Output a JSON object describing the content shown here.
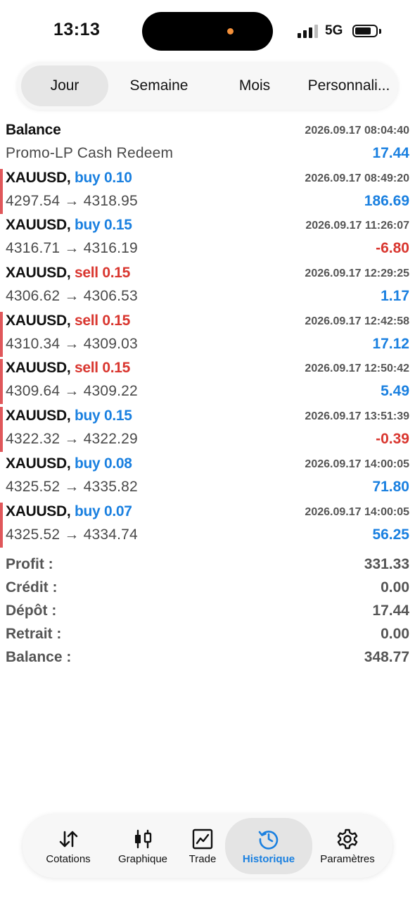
{
  "status_bar": {
    "time": "13:13",
    "network": "5G"
  },
  "period_tabs": [
    {
      "label": "Jour",
      "active": true
    },
    {
      "label": "Semaine",
      "active": false
    },
    {
      "label": "Mois",
      "active": false
    },
    {
      "label": "Personnali...",
      "active": false
    }
  ],
  "deals": [
    {
      "kind": "balance",
      "title": "Balance",
      "time": "2026.09.17 08:04:40",
      "detail": "Promo-LP Cash Redeem",
      "amount": "17.44",
      "sign": "pos",
      "marked": false
    },
    {
      "kind": "trade",
      "symbol": "XAUUSD,",
      "side": "buy",
      "volume": "0.10",
      "time": "2026.09.17 08:49:20",
      "open_price": "4297.54",
      "close_price": "4318.95",
      "amount": "186.69",
      "sign": "pos",
      "marked": true
    },
    {
      "kind": "trade",
      "symbol": "XAUUSD,",
      "side": "buy",
      "volume": "0.15",
      "time": "2026.09.17 11:26:07",
      "open_price": "4316.71",
      "close_price": "4316.19",
      "amount": "-6.80",
      "sign": "neg",
      "marked": false
    },
    {
      "kind": "trade",
      "symbol": "XAUUSD,",
      "side": "sell",
      "volume": "0.15",
      "time": "2026.09.17 12:29:25",
      "open_price": "4306.62",
      "close_price": "4306.53",
      "amount": "1.17",
      "sign": "pos",
      "marked": false
    },
    {
      "kind": "trade",
      "symbol": "XAUUSD,",
      "side": "sell",
      "volume": "0.15",
      "time": "2026.09.17 12:42:58",
      "open_price": "4310.34",
      "close_price": "4309.03",
      "amount": "17.12",
      "sign": "pos",
      "marked": true
    },
    {
      "kind": "trade",
      "symbol": "XAUUSD,",
      "side": "sell",
      "volume": "0.15",
      "time": "2026.09.17 12:50:42",
      "open_price": "4309.64",
      "close_price": "4309.22",
      "amount": "5.49",
      "sign": "pos",
      "marked": true
    },
    {
      "kind": "trade",
      "symbol": "XAUUSD,",
      "side": "buy",
      "volume": "0.15",
      "time": "2026.09.17 13:51:39",
      "open_price": "4322.32",
      "close_price": "4322.29",
      "amount": "-0.39",
      "sign": "neg",
      "marked": true
    },
    {
      "kind": "trade",
      "symbol": "XAUUSD,",
      "side": "buy",
      "volume": "0.08",
      "time": "2026.09.17 14:00:05",
      "open_price": "4325.52",
      "close_price": "4335.82",
      "amount": "71.80",
      "sign": "pos",
      "marked": false
    },
    {
      "kind": "trade",
      "symbol": "XAUUSD,",
      "side": "buy",
      "volume": "0.07",
      "time": "2026.09.17 14:00:05",
      "open_price": "4325.52",
      "close_price": "4334.74",
      "amount": "56.25",
      "sign": "pos",
      "marked": true
    }
  ],
  "summary": [
    {
      "label": "Profit :",
      "value": "331.33"
    },
    {
      "label": "Crédit :",
      "value": "0.00"
    },
    {
      "label": "Dépôt :",
      "value": "17.44"
    },
    {
      "label": "Retrait :",
      "value": "0.00"
    },
    {
      "label": "Balance :",
      "value": "348.77"
    }
  ],
  "bottom_nav": [
    {
      "label": "Cotations",
      "icon": "quotes-arrows-icon",
      "active": false
    },
    {
      "label": "Graphique",
      "icon": "candlestick-chart-icon",
      "active": false
    },
    {
      "label": "Trade",
      "icon": "trade-chart-icon",
      "active": false
    },
    {
      "label": "Historique",
      "icon": "history-clock-icon",
      "active": true
    },
    {
      "label": "Paramètres",
      "icon": "gear-icon",
      "active": false
    }
  ],
  "colors": {
    "positive": "#1a80e0",
    "negative": "#d9362f",
    "marker": "#e0575a",
    "island_dot": "#f3903a",
    "active_nav": "#1a80e0"
  }
}
